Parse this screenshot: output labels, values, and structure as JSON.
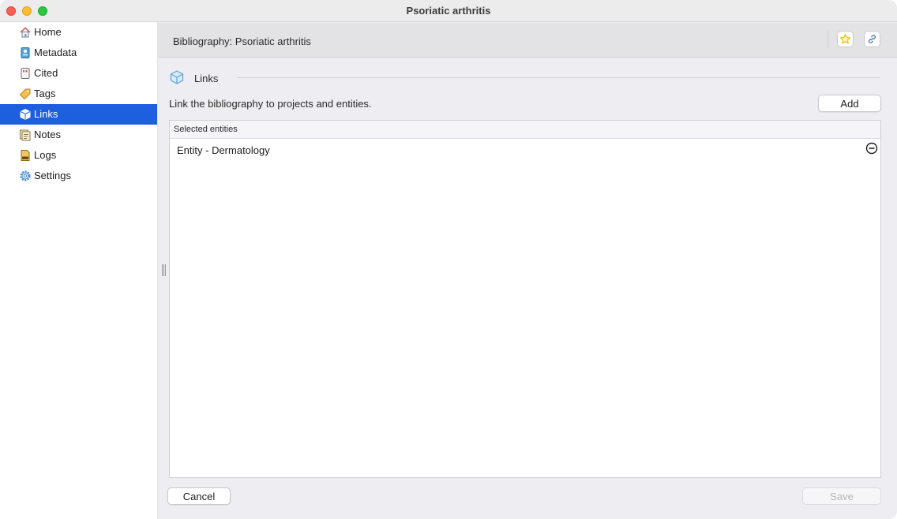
{
  "window": {
    "title": "Psoriatic arthritis"
  },
  "sidebar": {
    "items": [
      {
        "label": "Home",
        "icon": "home-icon",
        "active": false
      },
      {
        "label": "Metadata",
        "icon": "metadata-icon",
        "active": false
      },
      {
        "label": "Cited",
        "icon": "cited-icon",
        "active": false
      },
      {
        "label": "Tags",
        "icon": "tag-icon",
        "active": false
      },
      {
        "label": "Links",
        "icon": "cube-icon",
        "active": true
      },
      {
        "label": "Notes",
        "icon": "notes-icon",
        "active": false
      },
      {
        "label": "Logs",
        "icon": "logs-icon",
        "active": false
      },
      {
        "label": "Settings",
        "icon": "gear-icon",
        "active": false
      }
    ]
  },
  "header": {
    "title": "Bibliography: Psoriatic arthritis",
    "buttons": {
      "favorite_icon": "star-icon",
      "link_icon": "link-icon"
    }
  },
  "section": {
    "title": "Links",
    "icon": "cube-icon",
    "description": "Link the bibliography to projects and entities.",
    "add_label": "Add"
  },
  "table": {
    "column_header": "Selected entities",
    "rows": [
      {
        "label": "Entity - Dermatology",
        "action_icon": "remove-icon"
      }
    ]
  },
  "footer": {
    "cancel_label": "Cancel",
    "save_label": "Save",
    "save_enabled": false
  },
  "colors": {
    "accent": "#1e5fe0",
    "favorite": "#e8c21a"
  }
}
